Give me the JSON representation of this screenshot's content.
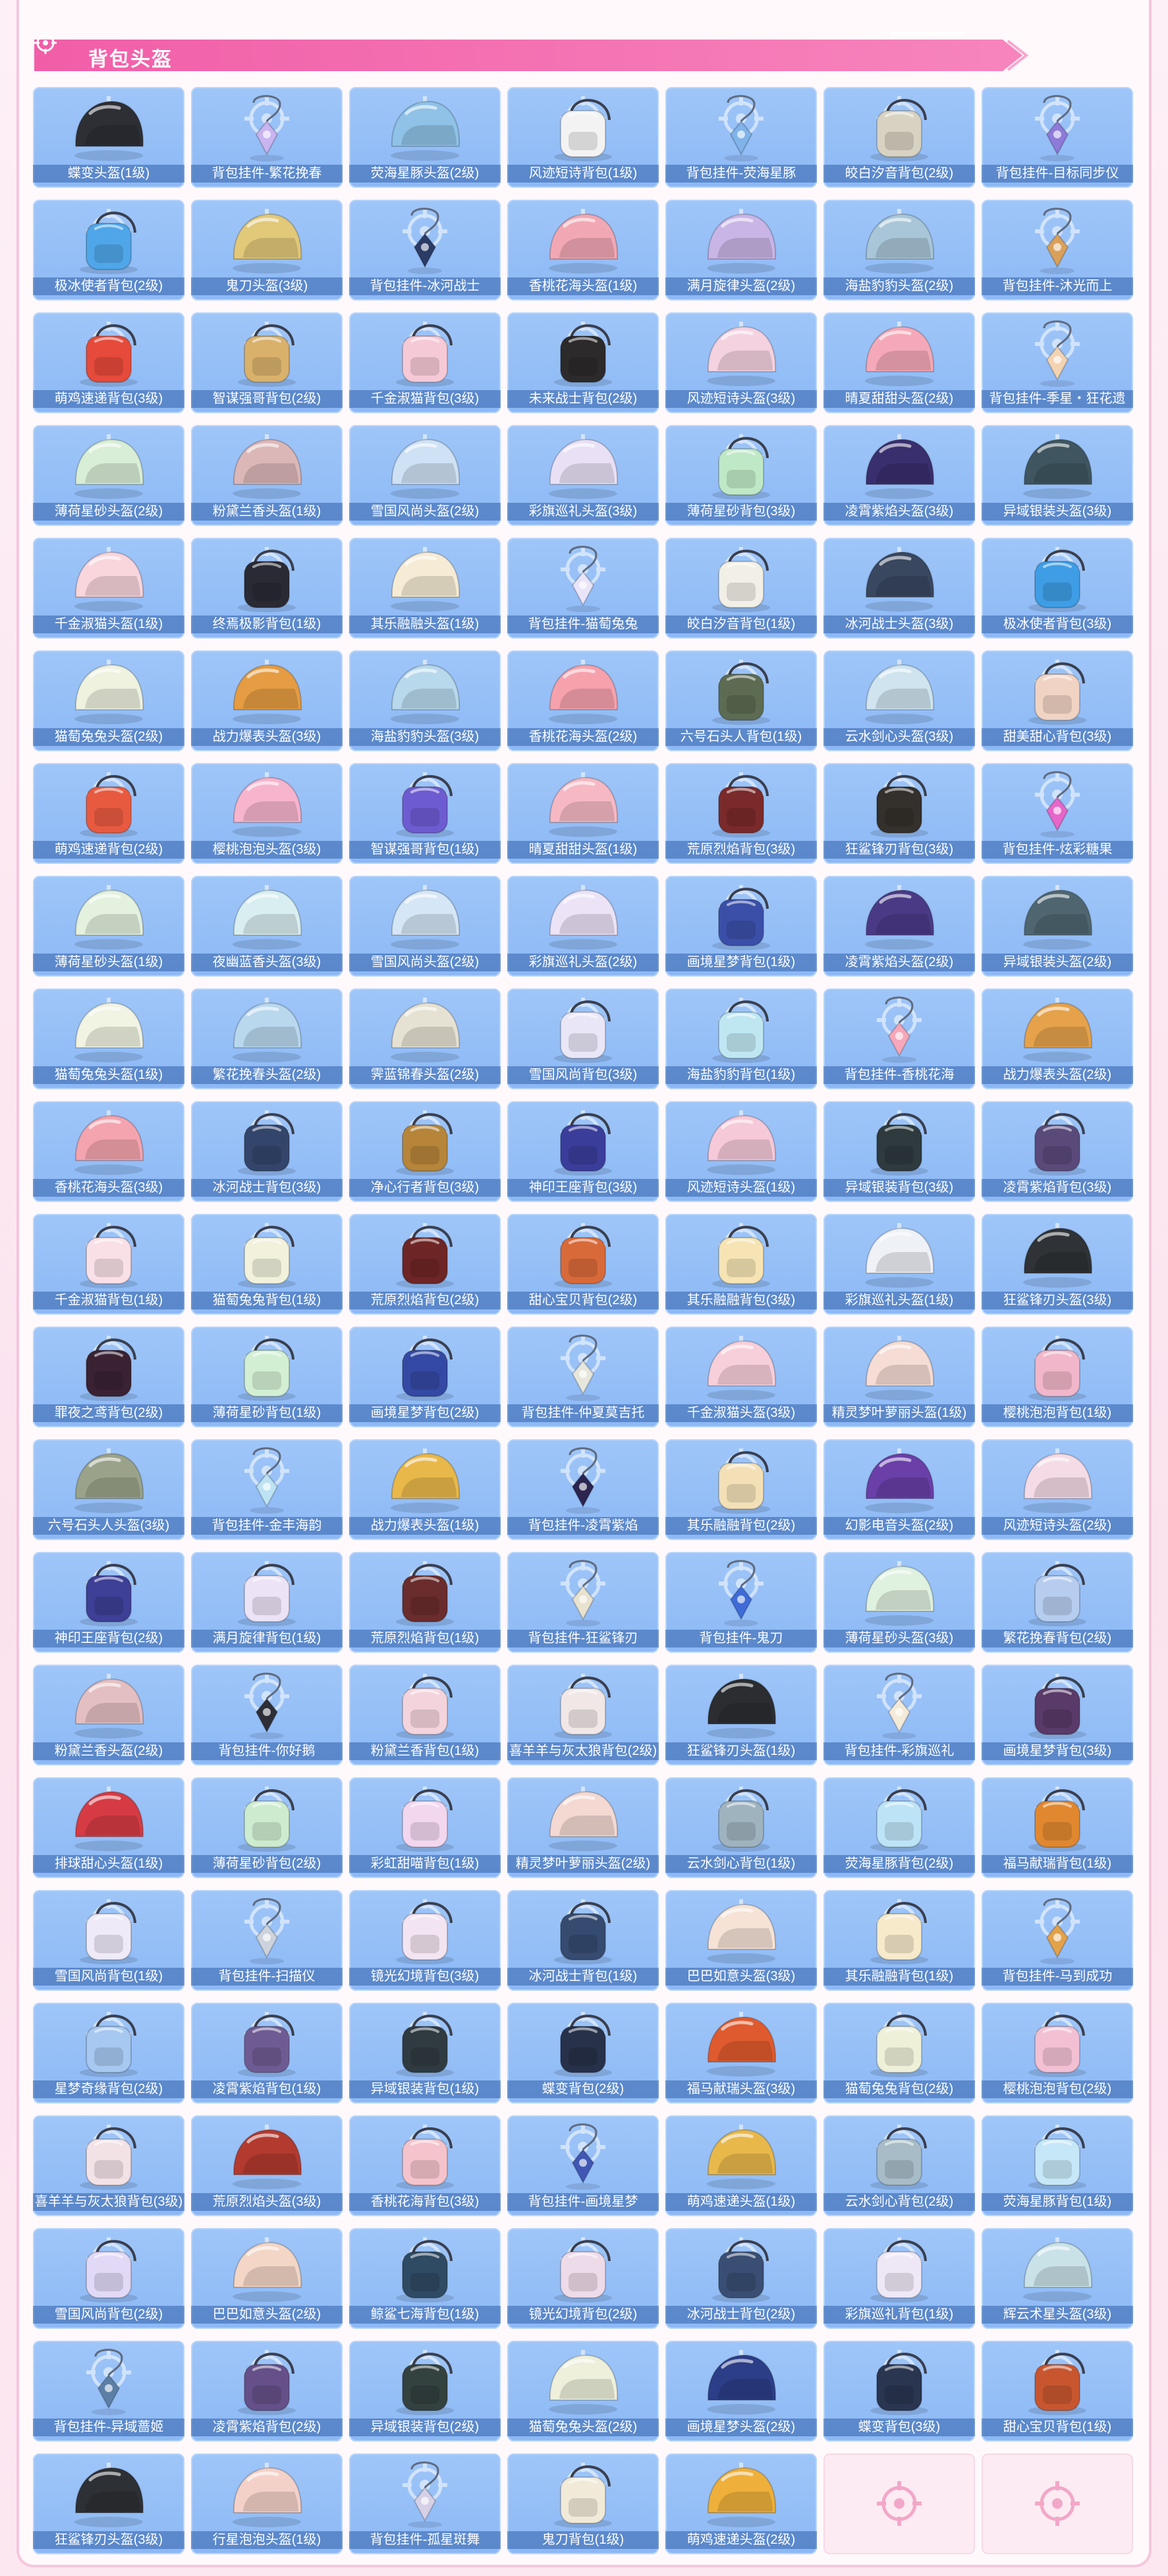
{
  "header": {
    "title": "背包头盔",
    "icon": "crosshair-icon"
  },
  "colors": {
    "header_bar": "#f36fae",
    "card_bg": "#9fc6f8",
    "label_bg": "#2c5ca5",
    "empty_card_bg": "#fcebf2",
    "empty_mark": "#f2a7c8"
  },
  "items": [
    {
      "label": "蝶变头盔(1级)",
      "kind": "helmet",
      "color": "#2d2f35"
    },
    {
      "label": "背包挂件-繁花挽春",
      "kind": "charm",
      "color": "#c9b4f0"
    },
    {
      "label": "荧海星豚头盔(2级)",
      "kind": "helmet",
      "color": "#8fc2e6"
    },
    {
      "label": "风迹短诗背包(1级)",
      "kind": "backpack",
      "color": "#f3f3f3"
    },
    {
      "label": "背包挂件-荧海星豚",
      "kind": "charm",
      "color": "#7fb3e9"
    },
    {
      "label": "皎白汐音背包(2级)",
      "kind": "backpack",
      "color": "#d8d2c2"
    },
    {
      "label": "背包挂件-目标同步仪",
      "kind": "charm",
      "color": "#8e7ad8"
    },
    {
      "label": "极冰使者背包(2级)",
      "kind": "backpack",
      "color": "#4fa6e8"
    },
    {
      "label": "鬼刀头盔(3级)",
      "kind": "helmet",
      "color": "#e2c879"
    },
    {
      "label": "背包挂件-冰河战士",
      "kind": "charm",
      "color": "#2a3b66"
    },
    {
      "label": "香桃花海头盔(1级)",
      "kind": "helmet",
      "color": "#f2a8b4"
    },
    {
      "label": "满月旋律头盔(2级)",
      "kind": "helmet",
      "color": "#c9b5e6"
    },
    {
      "label": "海盐豹豹头盔(2级)",
      "kind": "helmet",
      "color": "#a8c6d8"
    },
    {
      "label": "背包挂件-沐光而上",
      "kind": "charm",
      "color": "#d9a05a"
    },
    {
      "label": "萌鸡速递背包(3级)",
      "kind": "backpack",
      "color": "#e64a3a"
    },
    {
      "label": "智谋强哥背包(2级)",
      "kind": "backpack",
      "color": "#d9b16b"
    },
    {
      "label": "千金淑猫背包(3级)",
      "kind": "backpack",
      "color": "#f6c9d6"
    },
    {
      "label": "未来战士背包(2级)",
      "kind": "backpack",
      "color": "#2c2a2a"
    },
    {
      "label": "风迹短诗头盔(3级)",
      "kind": "helmet",
      "color": "#f4d2e0"
    },
    {
      "label": "晴夏甜甜头盔(2级)",
      "kind": "helmet",
      "color": "#f5a9b8"
    },
    {
      "label": "背包挂件-季星・狂花遗",
      "kind": "charm",
      "color": "#f2d3b2"
    },
    {
      "label": "薄荷星砂头盔(2级)",
      "kind": "helmet",
      "color": "#d9eed6"
    },
    {
      "label": "粉黛兰香头盔(1级)",
      "kind": "helmet",
      "color": "#dcb7b7"
    },
    {
      "label": "雪国风尚头盔(2级)",
      "kind": "helmet",
      "color": "#cfe1f5"
    },
    {
      "label": "彩旗巡礼头盔(3级)",
      "kind": "helmet",
      "color": "#e9e0f6"
    },
    {
      "label": "薄荷星砂背包(3级)",
      "kind": "backpack",
      "color": "#bfe8c6"
    },
    {
      "label": "凌霄紫焰头盔(3级)",
      "kind": "helmet",
      "color": "#3a2f6e"
    },
    {
      "label": "异域银装头盔(3级)",
      "kind": "helmet",
      "color": "#3f5660"
    },
    {
      "label": "千金淑猫头盔(1级)",
      "kind": "helmet",
      "color": "#f9d5dc"
    },
    {
      "label": "终焉极影背包(1级)",
      "kind": "backpack",
      "color": "#2a2a35"
    },
    {
      "label": "其乐融融头盔(1级)",
      "kind": "helmet",
      "color": "#f6ecd5"
    },
    {
      "label": "背包挂件-猫萄兔兔",
      "kind": "charm",
      "color": "#e9e4f8"
    },
    {
      "label": "皎白汐音背包(1级)",
      "kind": "backpack",
      "color": "#f2efe6"
    },
    {
      "label": "冰河战士头盔(3级)",
      "kind": "helmet",
      "color": "#39475f"
    },
    {
      "label": "极冰使者背包(3级)",
      "kind": "backpack",
      "color": "#3e9de4"
    },
    {
      "label": "猫萄兔兔头盔(2级)",
      "kind": "helmet",
      "color": "#eef2df"
    },
    {
      "label": "战力爆表头盔(3级)",
      "kind": "helmet",
      "color": "#e59c42"
    },
    {
      "label": "海盐豹豹头盔(3级)",
      "kind": "helmet",
      "color": "#b8d9ec"
    },
    {
      "label": "香桃花海头盔(2级)",
      "kind": "helmet",
      "color": "#f6a2ad"
    },
    {
      "label": "六号石头人背包(1级)",
      "kind": "backpack",
      "color": "#5c6b52"
    },
    {
      "label": "云水剑心头盔(3级)",
      "kind": "helmet",
      "color": "#cfe4ef"
    },
    {
      "label": "甜美甜心背包(3级)",
      "kind": "backpack",
      "color": "#f0d3c3"
    },
    {
      "label": "萌鸡速递背包(2级)",
      "kind": "backpack",
      "color": "#e85a40"
    },
    {
      "label": "樱桃泡泡头盔(3级)",
      "kind": "helmet",
      "color": "#f7b4cd"
    },
    {
      "label": "智谋强哥背包(1级)",
      "kind": "backpack",
      "color": "#6d5bd1"
    },
    {
      "label": "晴夏甜甜头盔(1级)",
      "kind": "helmet",
      "color": "#f6b9c4"
    },
    {
      "label": "荒原烈焰背包(3级)",
      "kind": "backpack",
      "color": "#7a2a2a"
    },
    {
      "label": "狂鲨锋刃背包(3级)",
      "kind": "backpack",
      "color": "#34302b"
    },
    {
      "label": "背包挂件-炫彩糖果",
      "kind": "charm",
      "color": "#e766c9"
    },
    {
      "label": "薄荷星砂头盔(1级)",
      "kind": "helmet",
      "color": "#e3f1de"
    },
    {
      "label": "夜幽蓝香头盔(3级)",
      "kind": "helmet",
      "color": "#d9eef0"
    },
    {
      "label": "雪国风尚头盔(2级)",
      "kind": "helmet",
      "color": "#d5e6f6"
    },
    {
      "label": "彩旗巡礼头盔(2级)",
      "kind": "helmet",
      "color": "#ece3f7"
    },
    {
      "label": "画境星梦背包(1级)",
      "kind": "backpack",
      "color": "#3b4fa8"
    },
    {
      "label": "凌霄紫焰头盔(2级)",
      "kind": "helmet",
      "color": "#4a3a86"
    },
    {
      "label": "异域银装头盔(2级)",
      "kind": "helmet",
      "color": "#4f6670"
    },
    {
      "label": "猫萄兔兔头盔(1级)",
      "kind": "helmet",
      "color": "#f1f3e3"
    },
    {
      "label": "繁花挽春头盔(2级)",
      "kind": "helmet",
      "color": "#b9d8ee"
    },
    {
      "label": "霁蓝锦春头盔(2级)",
      "kind": "helmet",
      "color": "#e6e2d3"
    },
    {
      "label": "雪国风尚背包(3级)",
      "kind": "backpack",
      "color": "#e9e6f7"
    },
    {
      "label": "海盐豹豹背包(1级)",
      "kind": "backpack",
      "color": "#bfe7f2"
    },
    {
      "label": "背包挂件-香桃花海",
      "kind": "charm",
      "color": "#f6a7b9"
    },
    {
      "label": "战力爆表头盔(2级)",
      "kind": "helmet",
      "color": "#e5a24b"
    },
    {
      "label": "香桃花海头盔(3级)",
      "kind": "helmet",
      "color": "#f4a4ae"
    },
    {
      "label": "冰河战士背包(3级)",
      "kind": "backpack",
      "color": "#33456b"
    },
    {
      "label": "净心行者背包(3级)",
      "kind": "backpack",
      "color": "#b6853a"
    },
    {
      "label": "神印王座背包(3级)",
      "kind": "backpack",
      "color": "#3b3d9b"
    },
    {
      "label": "风迹短诗头盔(1级)",
      "kind": "helmet",
      "color": "#f6c9d8"
    },
    {
      "label": "异域银装背包(3级)",
      "kind": "backpack",
      "color": "#2e3a3e"
    },
    {
      "label": "凌霄紫焰背包(3级)",
      "kind": "backpack",
      "color": "#5a4a7a"
    },
    {
      "label": "千金淑猫背包(1级)",
      "kind": "backpack",
      "color": "#f9e0e6"
    },
    {
      "label": "猫萄兔兔背包(1级)",
      "kind": "backpack",
      "color": "#f1f1dc"
    },
    {
      "label": "荒原烈焰背包(2级)",
      "kind": "backpack",
      "color": "#6e2525"
    },
    {
      "label": "甜心宝贝背包(2级)",
      "kind": "backpack",
      "color": "#d86a3a"
    },
    {
      "label": "其乐融融背包(3级)",
      "kind": "backpack",
      "color": "#f6e4b4"
    },
    {
      "label": "彩旗巡礼头盔(1级)",
      "kind": "helmet",
      "color": "#eef1f6"
    },
    {
      "label": "狂鲨锋刃头盔(3级)",
      "kind": "helmet",
      "color": "#2f3236"
    },
    {
      "label": "罪夜之鸢背包(2级)",
      "kind": "backpack",
      "color": "#3a2233"
    },
    {
      "label": "薄荷星砂背包(1级)",
      "kind": "backpack",
      "color": "#d3efd3"
    },
    {
      "label": "画境星梦背包(2级)",
      "kind": "backpack",
      "color": "#3449a3"
    },
    {
      "label": "背包挂件-仲夏莫吉托",
      "kind": "charm",
      "color": "#e7e6dc"
    },
    {
      "label": "千金淑猫头盔(3级)",
      "kind": "helmet",
      "color": "#f7cfda"
    },
    {
      "label": "精灵梦叶萝丽头盔(1级)",
      "kind": "helmet",
      "color": "#f5dcd4"
    },
    {
      "label": "樱桃泡泡背包(1级)",
      "kind": "backpack",
      "color": "#f1b6c9"
    },
    {
      "label": "六号石头人头盔(3级)",
      "kind": "helmet",
      "color": "#9aa38a"
    },
    {
      "label": "背包挂件-金丰海韵",
      "kind": "charm",
      "color": "#bde3f2"
    },
    {
      "label": "战力爆表头盔(1级)",
      "kind": "helmet",
      "color": "#e9b84a"
    },
    {
      "label": "背包挂件-凌霄紫焰",
      "kind": "charm",
      "color": "#2b2550"
    },
    {
      "label": "其乐融融背包(2级)",
      "kind": "backpack",
      "color": "#f3e0b7"
    },
    {
      "label": "幻影电音头盔(2级)",
      "kind": "helmet",
      "color": "#6a3fa8"
    },
    {
      "label": "风迹短诗头盔(2级)",
      "kind": "helmet",
      "color": "#f5dbe6"
    },
    {
      "label": "神印王座背包(2级)",
      "kind": "backpack",
      "color": "#3e3f96"
    },
    {
      "label": "满月旋律背包(1级)",
      "kind": "backpack",
      "color": "#ece3f6"
    },
    {
      "label": "荒原烈焰背包(1级)",
      "kind": "backpack",
      "color": "#6a2c2c"
    },
    {
      "label": "背包挂件-狂鲨锋刃",
      "kind": "charm",
      "color": "#e9e2cf"
    },
    {
      "label": "背包挂件-鬼刀",
      "kind": "charm",
      "color": "#3e6bd6"
    },
    {
      "label": "薄荷星砂头盔(3级)",
      "kind": "helmet",
      "color": "#dff1df"
    },
    {
      "label": "繁花挽春背包(2级)",
      "kind": "backpack",
      "color": "#b7cdef"
    },
    {
      "label": "粉黛兰香头盔(2级)",
      "kind": "helmet",
      "color": "#e4bfc1"
    },
    {
      "label": "背包挂件-你好鹅",
      "kind": "charm",
      "color": "#2e2e38"
    },
    {
      "label": "粉黛兰香背包(1级)",
      "kind": "backpack",
      "color": "#f4d4dc"
    },
    {
      "label": "喜羊羊与灰太狼背包(2级)",
      "kind": "backpack",
      "color": "#f1e7e7"
    },
    {
      "label": "狂鲨锋刃头盔(1级)",
      "kind": "helmet",
      "color": "#2b2d31"
    },
    {
      "label": "背包挂件-彩旗巡礼",
      "kind": "charm",
      "color": "#f4ead8"
    },
    {
      "label": "画境星梦背包(3级)",
      "kind": "backpack",
      "color": "#5a3a68"
    },
    {
      "label": "排球甜心头盔(1级)",
      "kind": "helmet",
      "color": "#d63b44"
    },
    {
      "label": "薄荷星砂背包(2级)",
      "kind": "backpack",
      "color": "#cdeccf"
    },
    {
      "label": "彩虹甜喵背包(1级)",
      "kind": "backpack",
      "color": "#f2d7ef"
    },
    {
      "label": "精灵梦叶萝丽头盔(2级)",
      "kind": "helmet",
      "color": "#f4d9d2"
    },
    {
      "label": "云水剑心背包(1级)",
      "kind": "backpack",
      "color": "#9fb3bf"
    },
    {
      "label": "荧海星豚背包(2级)",
      "kind": "backpack",
      "color": "#bde4f6"
    },
    {
      "label": "福马献瑞背包(1级)",
      "kind": "backpack",
      "color": "#e0872f"
    },
    {
      "label": "雪国风尚背包(1级)",
      "kind": "backpack",
      "color": "#eeeaf8"
    },
    {
      "label": "背包挂件-扫描仪",
      "kind": "charm",
      "color": "#cdd3dc"
    },
    {
      "label": "镜光幻境背包(3级)",
      "kind": "backpack",
      "color": "#f3e4f1"
    },
    {
      "label": "冰河战士背包(1级)",
      "kind": "backpack",
      "color": "#364b70"
    },
    {
      "label": "巴巴如意头盔(3级)",
      "kind": "helmet",
      "color": "#f6e3d6"
    },
    {
      "label": "其乐融融背包(1级)",
      "kind": "backpack",
      "color": "#f6eacb"
    },
    {
      "label": "背包挂件-马到成功",
      "kind": "charm",
      "color": "#e2a24a"
    },
    {
      "label": "星梦奇缘背包(2级)",
      "kind": "backpack",
      "color": "#a6c8f1"
    },
    {
      "label": "凌霄紫焰背包(1级)",
      "kind": "backpack",
      "color": "#6f5b93"
    },
    {
      "label": "异域银装背包(1级)",
      "kind": "backpack",
      "color": "#2f3b41"
    },
    {
      "label": "蝶变背包(2级)",
      "kind": "backpack",
      "color": "#27314a"
    },
    {
      "label": "福马献瑞头盔(3级)",
      "kind": "helmet",
      "color": "#df5a2e"
    },
    {
      "label": "猫萄兔兔背包(2级)",
      "kind": "backpack",
      "color": "#eef0d8"
    },
    {
      "label": "樱桃泡泡背包(2级)",
      "kind": "backpack",
      "color": "#f3c0d3"
    },
    {
      "label": "喜羊羊与灰太狼背包(3级)",
      "kind": "backpack",
      "color": "#f2e2e6"
    },
    {
      "label": "荒原烈焰头盔(3级)",
      "kind": "helmet",
      "color": "#b23a2f"
    },
    {
      "label": "香桃花海背包(3级)",
      "kind": "backpack",
      "color": "#f4c3cb"
    },
    {
      "label": "背包挂件-画境星梦",
      "kind": "charm",
      "color": "#4057b3"
    },
    {
      "label": "萌鸡速递头盔(1级)",
      "kind": "helmet",
      "color": "#e8b84b"
    },
    {
      "label": "云水剑心背包(2级)",
      "kind": "backpack",
      "color": "#a7bcc6"
    },
    {
      "label": "荧海星豚背包(1级)",
      "kind": "backpack",
      "color": "#c6e7f7"
    },
    {
      "label": "雪国风尚背包(2级)",
      "kind": "backpack",
      "color": "#e1d9f6"
    },
    {
      "label": "巴巴如意头盔(2级)",
      "kind": "helmet",
      "color": "#f3d6c6"
    },
    {
      "label": "鲸鲨七海背包(1级)",
      "kind": "backpack",
      "color": "#2f4a63"
    },
    {
      "label": "镜光幻境背包(2级)",
      "kind": "backpack",
      "color": "#eedbe9"
    },
    {
      "label": "冰河战士背包(2级)",
      "kind": "backpack",
      "color": "#3a4e73"
    },
    {
      "label": "彩旗巡礼背包(1级)",
      "kind": "backpack",
      "color": "#eee8f6"
    },
    {
      "label": "辉云术星头盔(3级)",
      "kind": "helmet",
      "color": "#c9e2e8"
    },
    {
      "label": "背包挂件-异域蔷姬",
      "kind": "charm",
      "color": "#5c7fa6"
    },
    {
      "label": "凌霄紫焰背包(2级)",
      "kind": "backpack",
      "color": "#655089"
    },
    {
      "label": "异域银装背包(2级)",
      "kind": "backpack",
      "color": "#33413f"
    },
    {
      "label": "猫萄兔兔头盔(2级)",
      "kind": "helmet",
      "color": "#eef0dc"
    },
    {
      "label": "画境星梦头盔(2级)",
      "kind": "helmet",
      "color": "#2c3e87"
    },
    {
      "label": "蝶变背包(3级)",
      "kind": "backpack",
      "color": "#2a3550"
    },
    {
      "label": "甜心宝贝背包(1级)",
      "kind": "backpack",
      "color": "#c7562f"
    },
    {
      "label": "狂鲨锋刃头盔(3级)",
      "kind": "helmet",
      "color": "#2d3035"
    },
    {
      "label": "行星泡泡头盔(1级)",
      "kind": "helmet",
      "color": "#f4d1c8"
    },
    {
      "label": "背包挂件-孤星斑舞",
      "kind": "charm",
      "color": "#d6d0e6"
    },
    {
      "label": "鬼刀背包(1级)",
      "kind": "backpack",
      "color": "#f1ead9"
    },
    {
      "label": "萌鸡速递头盔(2级)",
      "kind": "helmet",
      "color": "#eeb03a"
    },
    {
      "label": "",
      "kind": "empty",
      "color": ""
    },
    {
      "label": "",
      "kind": "empty",
      "color": ""
    }
  ]
}
